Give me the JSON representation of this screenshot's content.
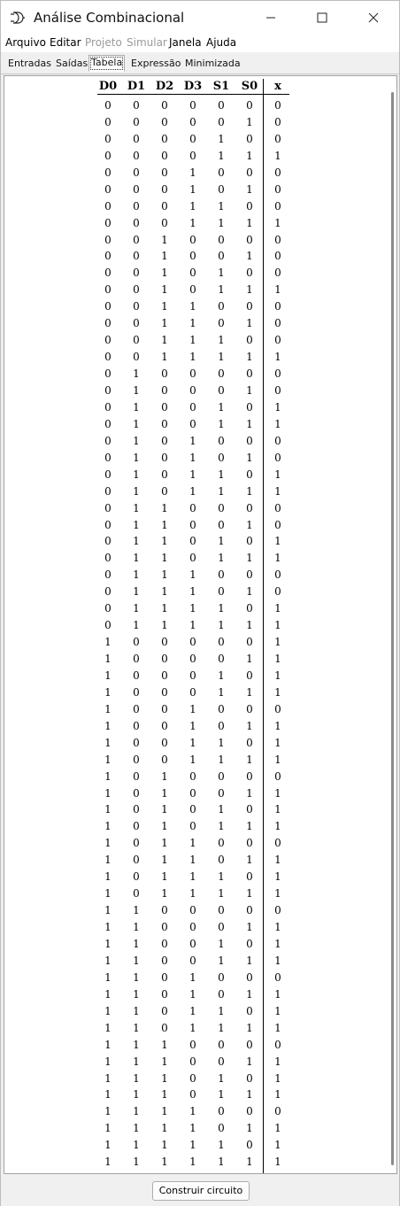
{
  "window": {
    "title": "Análise Combinacional",
    "icon": "logic-gate-icon",
    "controls": [
      "minimize-icon",
      "maximize-icon",
      "close-icon"
    ]
  },
  "menu": [
    {
      "label": "Arquivo",
      "enabled": true
    },
    {
      "label": "Editar",
      "enabled": true
    },
    {
      "label": "Projeto",
      "enabled": false
    },
    {
      "label": "Simular",
      "enabled": false
    },
    {
      "label": "Janela",
      "enabled": true
    },
    {
      "label": "Ajuda",
      "enabled": true
    }
  ],
  "tabs": [
    {
      "label": "Entradas",
      "active": false
    },
    {
      "label": "Saídas",
      "active": false
    },
    {
      "label": "Tabela",
      "active": true
    },
    {
      "label": "Expressão",
      "active": false
    },
    {
      "label": "Minimizada",
      "active": false
    }
  ],
  "table": {
    "inputs": [
      "D0",
      "D1",
      "D2",
      "D3",
      "S1",
      "S0"
    ],
    "outputs": [
      "x"
    ],
    "x_values": "0001000100010001001100110011001111110111011101110111011101110111",
    "x_values_note": "",
    "rows": []
  },
  "footer": {
    "build_button": "Construir circuito"
  }
}
